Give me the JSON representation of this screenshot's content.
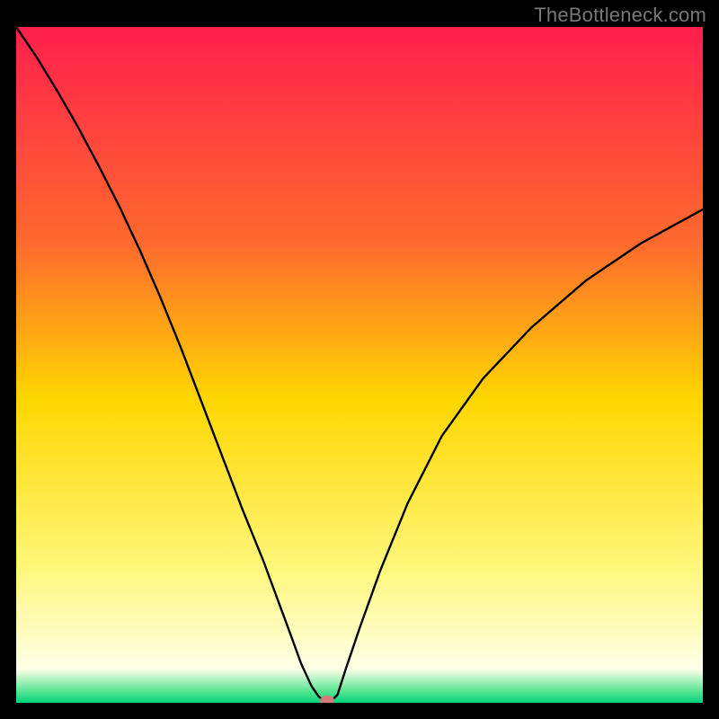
{
  "watermark": "TheBottleneck.com",
  "chart_data": {
    "type": "line",
    "title": "",
    "xlabel": "",
    "ylabel": "",
    "xlim": [
      0,
      1
    ],
    "ylim": [
      0,
      1
    ],
    "grid": false,
    "gradient_stops": [
      {
        "offset": 0.0,
        "color": "#ff1f4d"
      },
      {
        "offset": 0.32,
        "color": "#ff6a2e"
      },
      {
        "offset": 0.55,
        "color": "#ffd600"
      },
      {
        "offset": 0.8,
        "color": "#fff77a"
      },
      {
        "offset": 0.95,
        "color": "#ffffe8"
      },
      {
        "offset": 0.985,
        "color": "#4de38c"
      },
      {
        "offset": 1.0,
        "color": "#00d27a"
      }
    ],
    "series": [
      {
        "name": "bottleneck-curve",
        "x": [
          0.0,
          0.03,
          0.06,
          0.09,
          0.12,
          0.15,
          0.18,
          0.21,
          0.24,
          0.27,
          0.3,
          0.33,
          0.36,
          0.38,
          0.4,
          0.415,
          0.43,
          0.44,
          0.448,
          0.453,
          0.458,
          0.468,
          0.48,
          0.5,
          0.53,
          0.57,
          0.62,
          0.68,
          0.75,
          0.83,
          0.91,
          1.0
        ],
        "y": [
          1.0,
          0.955,
          0.905,
          0.852,
          0.795,
          0.735,
          0.67,
          0.6,
          0.525,
          0.445,
          0.365,
          0.285,
          0.21,
          0.155,
          0.1,
          0.058,
          0.025,
          0.01,
          0.003,
          0.0,
          0.002,
          0.012,
          0.05,
          0.11,
          0.195,
          0.295,
          0.395,
          0.48,
          0.555,
          0.625,
          0.68,
          0.73
        ]
      }
    ],
    "marker": {
      "x": 0.453,
      "y": 0.003,
      "color": "#d27a7e"
    }
  }
}
